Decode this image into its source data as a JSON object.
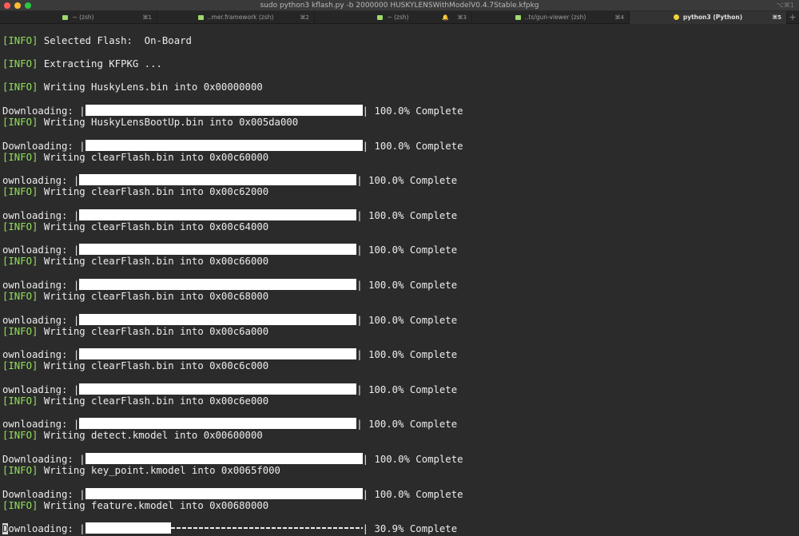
{
  "window": {
    "title": "sudo python3 kflash.py -b 2000000 HUSKYLENSWithModelV0.4.7Stable.kfpkg",
    "shortcut": "⌥⌘1"
  },
  "tabs": [
    {
      "label": "~ (zsh)",
      "shortcut": "⌘1",
      "icon": "terminal-icon",
      "active": false
    },
    {
      "label": "..mer.framework (zsh)",
      "shortcut": "⌘2",
      "icon": "terminal-icon",
      "active": false
    },
    {
      "label": "~ (zsh)",
      "shortcut": "⌘3",
      "icon": "terminal-icon",
      "bell": "🔔",
      "active": false
    },
    {
      "label": "..ts/gun-viewer (zsh)",
      "shortcut": "⌘4",
      "icon": "terminal-icon",
      "active": false
    },
    {
      "label": "python3 (Python)",
      "shortcut": "⌘5",
      "icon": "python-icon",
      "active": true
    }
  ],
  "new_tab_label": "+",
  "colors": {
    "info_tag": "#92e05c",
    "background": "#2b2b2b",
    "text": "#ececec"
  },
  "terminal": {
    "info_tag": "[INFO]",
    "flash_line": "Selected Flash:  On-Board",
    "extract_line": "Extracting KFPKG ...",
    "writes": [
      "Writing HuskyLens.bin into 0x00000000",
      "Writing HuskyLensBootUp.bin into 0x005da000",
      "Writing clearFlash.bin into 0x00c60000",
      "Writing clearFlash.bin into 0x00c62000",
      "Writing clearFlash.bin into 0x00c64000",
      "Writing clearFlash.bin into 0x00c66000",
      "Writing clearFlash.bin into 0x00c68000",
      "Writing clearFlash.bin into 0x00c6a000",
      "Writing clearFlash.bin into 0x00c6c000",
      "Writing clearFlash.bin into 0x00c6e000",
      "Writing detect.kmodel into 0x00600000",
      "Writing key_point.kmodel into 0x0065f000",
      "Writing feature.kmodel into 0x00680000"
    ],
    "downloads": [
      {
        "label": "Downloading: ",
        "pipe": "|",
        "progress": 1.0,
        "status": "100.0% Complete"
      },
      {
        "label": "Downloading: ",
        "pipe": "|",
        "progress": 1.0,
        "status": "100.0% Complete"
      },
      {
        "label": "ownloading: ",
        "pipe": "|",
        "progress": 1.0,
        "status": "100.0% Complete"
      },
      {
        "label": "ownloading: ",
        "pipe": "|",
        "progress": 1.0,
        "status": "100.0% Complete"
      },
      {
        "label": "ownloading: ",
        "pipe": "|",
        "progress": 1.0,
        "status": "100.0% Complete"
      },
      {
        "label": "ownloading: ",
        "pipe": "|",
        "progress": 1.0,
        "status": "100.0% Complete"
      },
      {
        "label": "ownloading: ",
        "pipe": "|",
        "progress": 1.0,
        "status": "100.0% Complete"
      },
      {
        "label": "ownloading: ",
        "pipe": "|",
        "progress": 1.0,
        "status": "100.0% Complete"
      },
      {
        "label": "ownloading: ",
        "pipe": "|",
        "progress": 1.0,
        "status": "100.0% Complete"
      },
      {
        "label": "ownloading: ",
        "pipe": "|",
        "progress": 1.0,
        "status": "100.0% Complete"
      },
      {
        "label": "Downloading: ",
        "pipe": "|",
        "progress": 1.0,
        "status": "100.0% Complete"
      },
      {
        "label": "Downloading: ",
        "pipe": "|",
        "progress": 1.0,
        "status": "100.0% Complete"
      },
      {
        "label": "Downloading: ",
        "pipe": "|",
        "progress": 0.309,
        "status": "30.9% Complete"
      }
    ]
  }
}
